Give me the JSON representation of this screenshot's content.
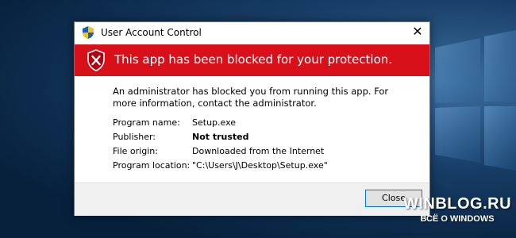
{
  "window": {
    "title": "User Account Control",
    "close_glyph": "✕",
    "title_icon": "uac-shield-icon"
  },
  "banner": {
    "text": "This app has been blocked for your protection.",
    "icon": "blocked-shield-icon",
    "color": "#d7101a"
  },
  "message": "An administrator has blocked you from running this app. For more information, contact the administrator.",
  "details": [
    {
      "label": "Program name:",
      "value": "Setup.exe"
    },
    {
      "label": "Publisher:",
      "value": "Not trusted"
    },
    {
      "label": "File origin:",
      "value": "Downloaded from the Internet"
    },
    {
      "label": "Program location:",
      "value": "\"C:\\Users\\J\\Desktop\\Setup.exe\""
    }
  ],
  "buttons": {
    "close_label": "Close"
  },
  "watermark": {
    "line1": "WINBLOG.RU",
    "line2": "ВСЁ О WINDOWS"
  }
}
